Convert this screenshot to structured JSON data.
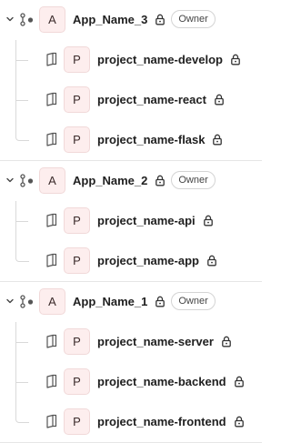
{
  "groups": [
    {
      "avatar": "A",
      "name": "App_Name_3",
      "role": "Owner",
      "expanded": true,
      "projects": [
        {
          "avatar": "P",
          "name": "project_name-develop"
        },
        {
          "avatar": "P",
          "name": "project_name-react"
        },
        {
          "avatar": "P",
          "name": "project_name-flask"
        }
      ]
    },
    {
      "avatar": "A",
      "name": "App_Name_2",
      "role": "Owner",
      "expanded": true,
      "projects": [
        {
          "avatar": "P",
          "name": "project_name-api"
        },
        {
          "avatar": "P",
          "name": "project_name-app"
        }
      ]
    },
    {
      "avatar": "A",
      "name": "App_Name_1",
      "role": "Owner",
      "expanded": true,
      "projects": [
        {
          "avatar": "P",
          "name": "project_name-server"
        },
        {
          "avatar": "P",
          "name": "project_name-backend"
        },
        {
          "avatar": "P",
          "name": "project_name-frontend"
        }
      ]
    }
  ],
  "icons": {
    "chevron": "chevron-down-icon",
    "group": "group-icon",
    "lock": "lock-icon",
    "project": "book-icon"
  }
}
